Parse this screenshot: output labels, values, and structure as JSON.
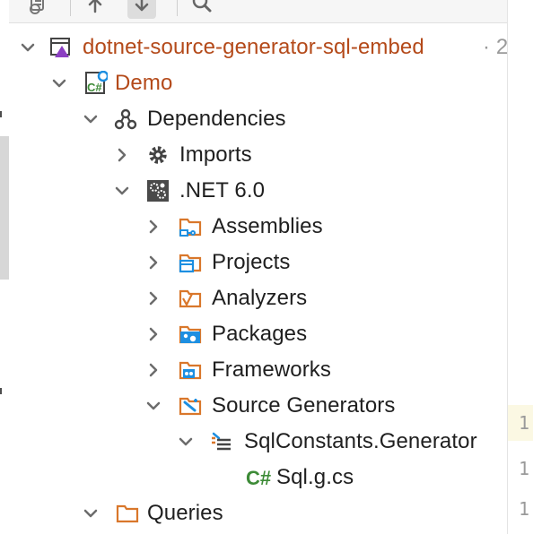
{
  "toolbar": {
    "buttons": [
      {
        "name": "project-files-icon",
        "active": false
      },
      {
        "name": "arrow-up-icon",
        "active": false
      },
      {
        "name": "arrow-down-icon",
        "active": true
      },
      {
        "name": "search-icon",
        "active": false
      }
    ]
  },
  "tree": {
    "solution": {
      "label": "dotnet-source-generator-sql-embed",
      "suffix": " · 2"
    },
    "project": {
      "label": "Demo"
    },
    "dependencies": {
      "label": "Dependencies"
    },
    "imports": {
      "label": "Imports"
    },
    "framework": {
      "label": ".NET 6.0"
    },
    "assemblies": {
      "label": "Assemblies"
    },
    "projects": {
      "label": "Projects"
    },
    "analyzers": {
      "label": "Analyzers"
    },
    "packages": {
      "label": "Packages"
    },
    "frameworks": {
      "label": "Frameworks"
    },
    "source_generators": {
      "label": "Source Generators"
    },
    "generator": {
      "label": "SqlConstants.Generator"
    },
    "generated_file": {
      "label": "Sql.g.cs"
    },
    "queries": {
      "label": "Queries"
    }
  },
  "editor": {
    "line_numbers": [
      "1",
      "1",
      "1"
    ]
  },
  "colors": {
    "project_text": "#b44a1a",
    "folder_orange": "#d9772b",
    "blue_icon": "#1d8fe1",
    "csharp_green": "#3d8b37"
  }
}
